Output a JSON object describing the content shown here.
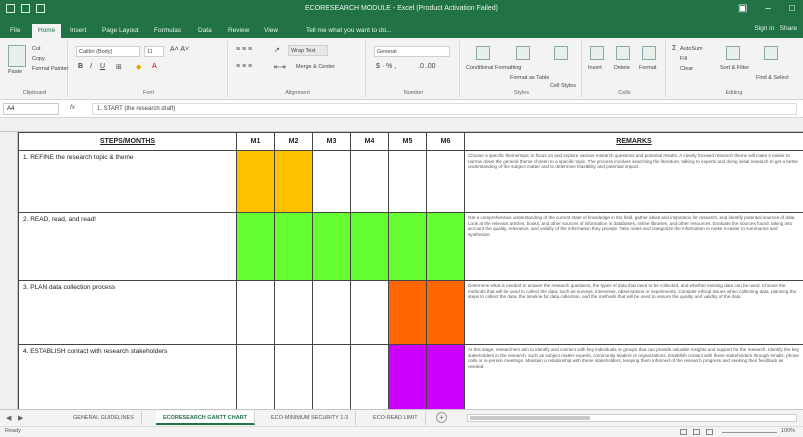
{
  "window": {
    "title": "ECORESEARCH MODULE - Excel (Product Activation Failed)"
  },
  "ribbon_tabs": {
    "file": "File",
    "home": "Home",
    "insert": "Insert",
    "page_layout": "Page Layout",
    "formulas": "Formulas",
    "data": "Data",
    "review": "Review",
    "view": "View",
    "tell_me": "Tell me what you want to do...",
    "sign_in": "Sign in",
    "share": "Share"
  },
  "ribbon": {
    "clipboard": {
      "label": "Clipboard",
      "paste": "Paste",
      "cut": "Cut",
      "copy": "Copy",
      "format_painter": "Format Painter"
    },
    "font": {
      "label": "Font",
      "font_name": "Calibri (Body)",
      "font_size": "11"
    },
    "alignment": {
      "label": "Alignment",
      "wrap_text": "Wrap Text",
      "merge_center": "Merge & Center"
    },
    "number": {
      "label": "Number",
      "format": "General"
    },
    "styles": {
      "label": "Styles",
      "conditional": "Conditional Formatting",
      "format_table": "Format as Table",
      "cell_styles": "Cell Styles"
    },
    "cells": {
      "label": "Cells",
      "insert": "Insert",
      "delete": "Delete",
      "format": "Format"
    },
    "editing": {
      "label": "Editing",
      "autosum": "AutoSum",
      "fill": "Fill",
      "clear": "Clear",
      "sort_filter": "Sort & Filter",
      "find_select": "Find & Select"
    }
  },
  "formula_bar": {
    "name_box": "A4",
    "fx": "fx",
    "value": "1. START (the research draft)"
  },
  "sheet": {
    "headers": {
      "steps": "STEPS/MONTHS",
      "months": [
        "M1",
        "M2",
        "M3",
        "M4",
        "M5",
        "M6"
      ],
      "remarks": "REMARKS"
    },
    "col_letters": [
      "A",
      "B",
      "C",
      "D",
      "E",
      "F",
      "G",
      "H"
    ],
    "row_numbers": [
      "3",
      "4",
      "5",
      "6",
      "7"
    ],
    "rows": [
      {
        "step": "1. REFINE the research topic & theme",
        "remarks": "Choose a specific theme/topic to focus on and explore various research questions and potential results. A clearly focused research theme will make it easier to narrow down the general theme chosen to a specific topic. The process involves searching the literature, talking to experts and doing initial research to get a better understanding of the subject matter and to determine feasibility and potential impact."
      },
      {
        "step": "2. READ, read, and read!",
        "remarks": "Get a comprehensive understanding of the current state of knowledge in the field, gather ideas and inspiration for research, and identify potential sources of data. Look at the relevant articles, books, and other sources of information in databases, online libraries, and other resources. Evaluate the sources found, taking into account the quality, relevance, and validity of the information they provide. Take notes and categorize the information to make it easier to summarize and synthesize."
      },
      {
        "step": "3. PLAN data collection process",
        "remarks": "Determine what is needed to answer the research questions, the types of data that need to be collected, and whether existing data can be used. Choose the methods that will be used to collect the data, such as surveys, interviews, observations or experiments. Consider ethical issues when collecting data, planning the steps to collect the data, the timeline for data collection, and the methods that will be used to ensure the quality and validity of the data."
      },
      {
        "step": "4. ESTABLISH contact with research stakeholders",
        "remarks": "At this stage, researchers aim to identify and connect with key individuals or groups that can provide valuable insights and support for the research. Identify the key stakeholders in the research, such as subject matter experts, community leaders or organizations. Establish contact with these stakeholders through emails, phone calls or in-person meetings. Maintain a relationship with these stakeholders, keeping them informed of the research progress and seeking their feedback as needed."
      }
    ],
    "gantt": [
      [
        true,
        true,
        false,
        false,
        false,
        false
      ],
      [
        true,
        true,
        true,
        true,
        true,
        true
      ],
      [
        false,
        false,
        false,
        false,
        true,
        true
      ],
      [
        false,
        false,
        false,
        false,
        true,
        true
      ]
    ],
    "row_colors": [
      "#ffc000",
      "#66ff33",
      "#ff6600",
      "#cc00ff"
    ]
  },
  "sheet_tabs": {
    "tabs": [
      "GENERAL GUIDELINES",
      "ECORESEARCH GANTT CHART",
      "ECO-MINIMUM SECURITY 1-3",
      "ECO-READ LIMIT"
    ],
    "active_index": 1,
    "add": "+"
  },
  "status_bar": {
    "ready": "Ready",
    "zoom": "100%"
  },
  "colors": {
    "excel_green": "#217346",
    "ribbon_bg": "#f3f3f3"
  }
}
